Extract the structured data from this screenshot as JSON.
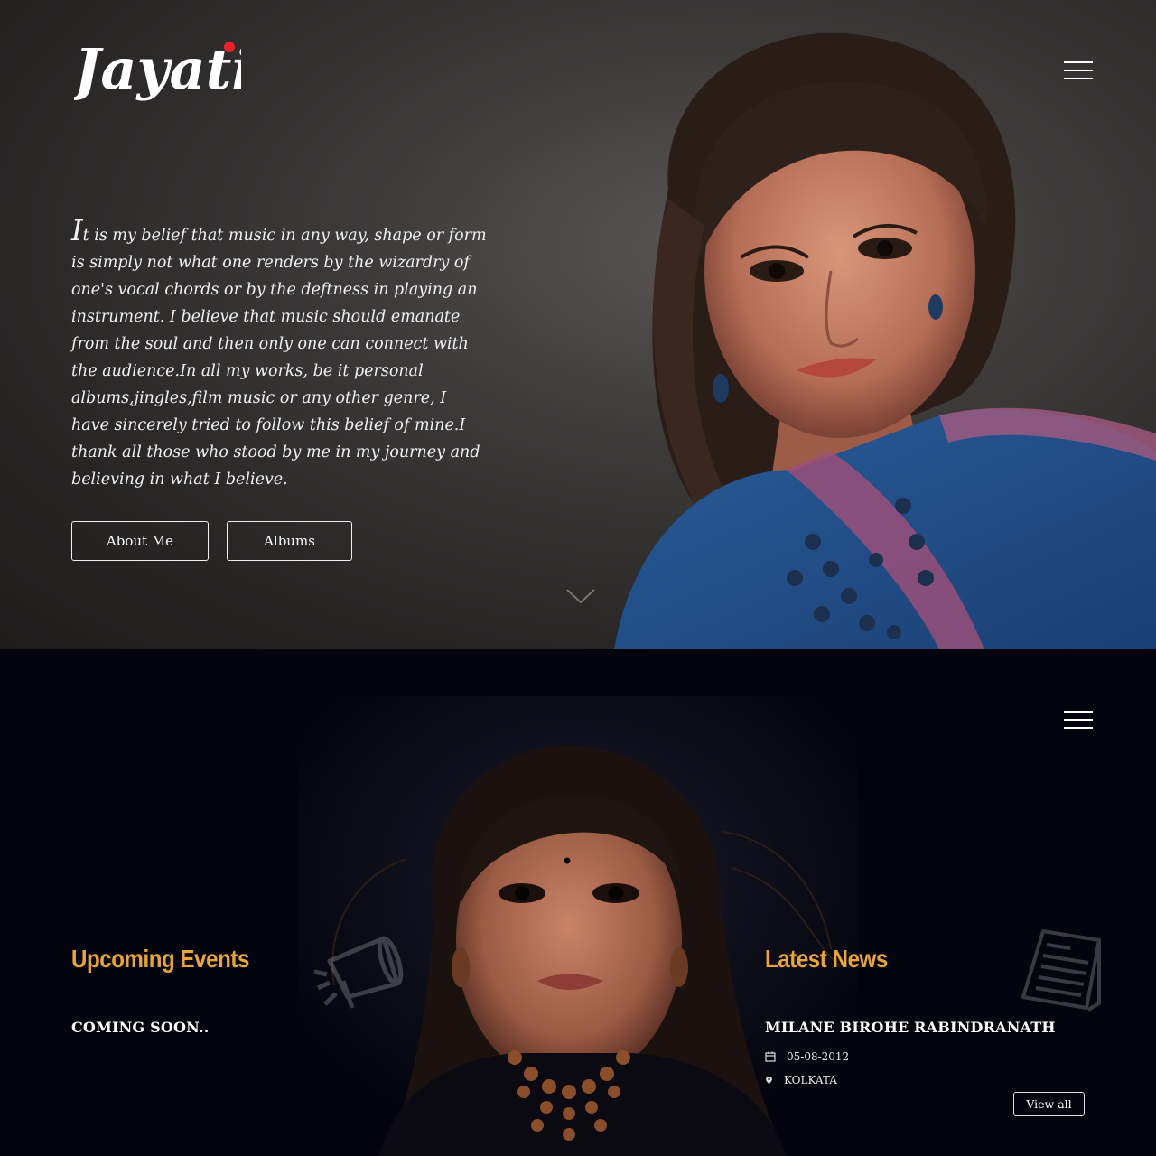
{
  "brand": {
    "logo_text": "Jayati",
    "logo_dot_color": "#e8202a"
  },
  "hero": {
    "quote_first_letter": "I",
    "quote_rest": "t is my belief that music in any way, shape or form is simply not what one renders by the wizardry of one's vocal chords or by the deftness in playing an instrument. I believe that music should emanate from the soul and then only one can connect with the audience.In all my works, be it personal albums,jingles,film music or any other genre, I have sincerely tried to follow this belief of mine.I thank all those who stood by me in my journey and believing in what I believe.",
    "about_label": "About Me",
    "albums_label": "Albums"
  },
  "events": {
    "title": "Upcoming Events",
    "title_color": "#e9a53a",
    "status": "COMING SOON.."
  },
  "news": {
    "title": "Latest News",
    "title_color": "#e9a53a",
    "headline": "MILANE BIROHE RABINDRANATH",
    "date": "05-08-2012",
    "location": "KOLKATA",
    "view_all_label": "View all"
  },
  "icons": {
    "menu": "hamburger-icon",
    "chevron": "chevron-down-icon",
    "calendar": "calendar-icon",
    "location": "map-pin-icon",
    "events_decor": "megaphone-icon",
    "news_decor": "newspaper-icon"
  }
}
